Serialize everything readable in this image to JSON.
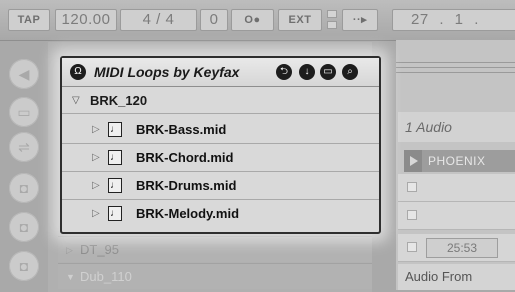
{
  "transport": {
    "tap": "TAP",
    "tempo": "120.00",
    "time_signature": "4 / 4",
    "offset": "0",
    "metronome": "O●",
    "ext": "EXT",
    "arrangement_follow": "··▸",
    "position": "27 . 1 ."
  },
  "left_icons": [
    "chevron-left-icon",
    "window-icon",
    "plugin-icon",
    "disk-icon",
    "disk-icon",
    "disk-icon"
  ],
  "popup": {
    "title": "MIDI Loops by Keyfax",
    "icons": [
      "headphones-icon",
      "back-icon",
      "download-icon",
      "view-icon",
      "search-icon"
    ],
    "folder": "BRK_120",
    "files": [
      {
        "name": "BRK-Bass.mid",
        "icon": "♩"
      },
      {
        "name": "BRK-Chord.mid",
        "icon": "♩"
      },
      {
        "name": "BRK-Drums.mid",
        "icon": "♩"
      },
      {
        "name": "BRK-Melody.mid",
        "icon": "♩"
      }
    ]
  },
  "browser_bg": {
    "items": [
      "DT_95",
      "Dub_110"
    ]
  },
  "session": {
    "track_name": "1 Audio",
    "clip_name": "PHOENIX",
    "time": "25:53",
    "audio_from": "Audio From"
  },
  "colors": {
    "background": "#a9a9a9",
    "popup_border": "#2e2e2e",
    "popup_bg": "#d9d9d9"
  }
}
